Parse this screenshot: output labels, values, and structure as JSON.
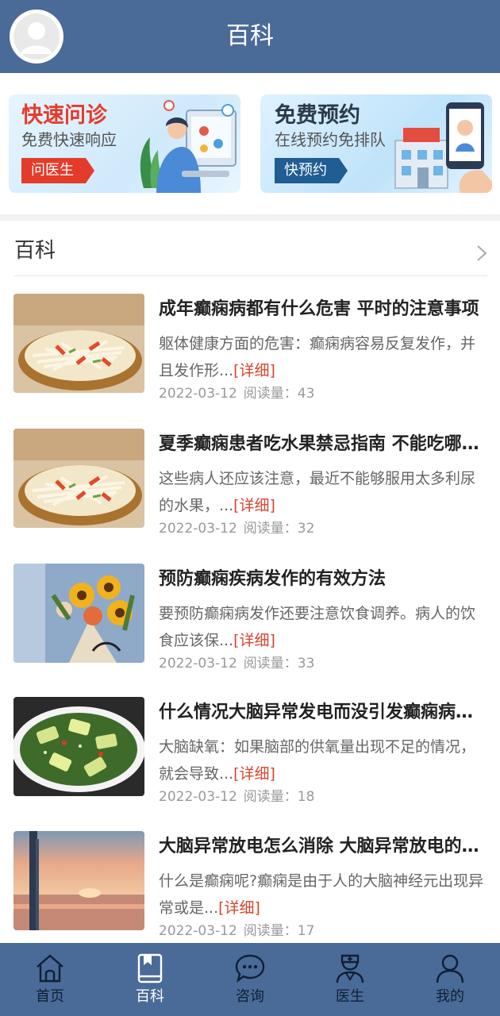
{
  "header": {
    "title": "百科"
  },
  "banners": [
    {
      "title": "快速问诊",
      "subtitle": "免费快速响应",
      "button": "问医生"
    },
    {
      "title": "免费预约",
      "subtitle": "在线预约免排队",
      "button": "快预约"
    }
  ],
  "section": {
    "title": "百科"
  },
  "articles": [
    {
      "title": "成年癫痫病都有什么危害 平时的注意事项",
      "summary": "躯体健康方面的危害：癫痫病容易反复发作，并且发作形...",
      "more": "[详细]",
      "date": "2022-03-12",
      "views": "阅读量：43",
      "thumb": "noodle-salad-image"
    },
    {
      "title": "夏季癫痫患者吃水果禁忌指南 不能吃哪些水果",
      "summary": "这些病人还应该注意，最近不能够服用太多利尿的水果，...",
      "more": "[详细]",
      "date": "2022-03-12",
      "views": "阅读量：32",
      "thumb": "noodle-salad-image"
    },
    {
      "title": "预防癫痫疾病发作的有效方法",
      "summary": "要预防癫痫病发作还要注意饮食调养。病人的饮食应该保...",
      "more": "[详细]",
      "date": "2022-03-12",
      "views": "阅读量：33",
      "thumb": "sunflower-bouquet-image"
    },
    {
      "title": "什么情况大脑异常发电而没引发癫痫病发作",
      "summary": "大脑缺氧：如果脑部的供氧量出现不足的情况，就会导致...",
      "more": "[详细]",
      "date": "2022-03-12",
      "views": "阅读量：18",
      "thumb": "cucumber-salad-image"
    },
    {
      "title": "大脑异常放电怎么消除 大脑异常放电的原因",
      "summary": "什么是癫痫呢?癫痫是由于人的大脑神经元出现异常或是...",
      "more": "[详细]",
      "date": "2022-03-12",
      "views": "阅读量：17",
      "thumb": "sunset-sea-image"
    }
  ],
  "tabs": [
    {
      "label": "首页",
      "icon": "home-icon",
      "active": false
    },
    {
      "label": "百科",
      "icon": "book-icon",
      "active": true
    },
    {
      "label": "咨询",
      "icon": "chat-icon",
      "active": false
    },
    {
      "label": "医生",
      "icon": "doctor-icon",
      "active": false
    },
    {
      "label": "我的",
      "icon": "user-icon",
      "active": false
    }
  ],
  "colors": {
    "header": "#4a6a97",
    "accent_red": "#e53b2a",
    "link_red": "#d9442f",
    "tab_active": "#ffffff",
    "tab_inactive": "#0f1f35"
  }
}
